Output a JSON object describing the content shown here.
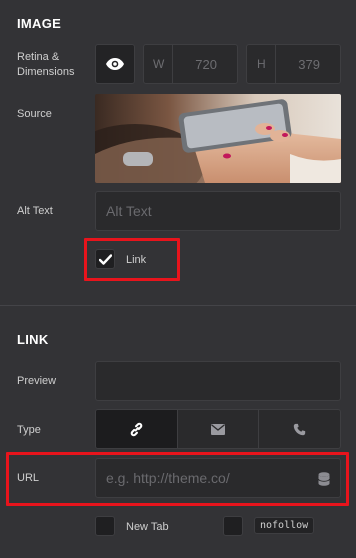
{
  "image_section": {
    "title": "IMAGE",
    "retina_label": "Retina & Dimensions",
    "width_letter": "W",
    "width_value": "720",
    "height_letter": "H",
    "height_value": "379",
    "source_label": "Source",
    "alt_label": "Alt Text",
    "alt_placeholder": "Alt Text",
    "link_checkbox_label": "Link",
    "link_checked": true
  },
  "link_section": {
    "title": "LINK",
    "preview_label": "Preview",
    "type_label": "Type",
    "type_options": [
      "link-icon",
      "envelope-icon",
      "phone-icon"
    ],
    "type_selected": "link-icon",
    "url_label": "URL",
    "url_placeholder": "e.g. http://theme.co/",
    "new_tab_label": "New Tab",
    "nofollow_label": "nofollow"
  },
  "colors": {
    "background": "#333336",
    "highlight": "#e8141c"
  }
}
